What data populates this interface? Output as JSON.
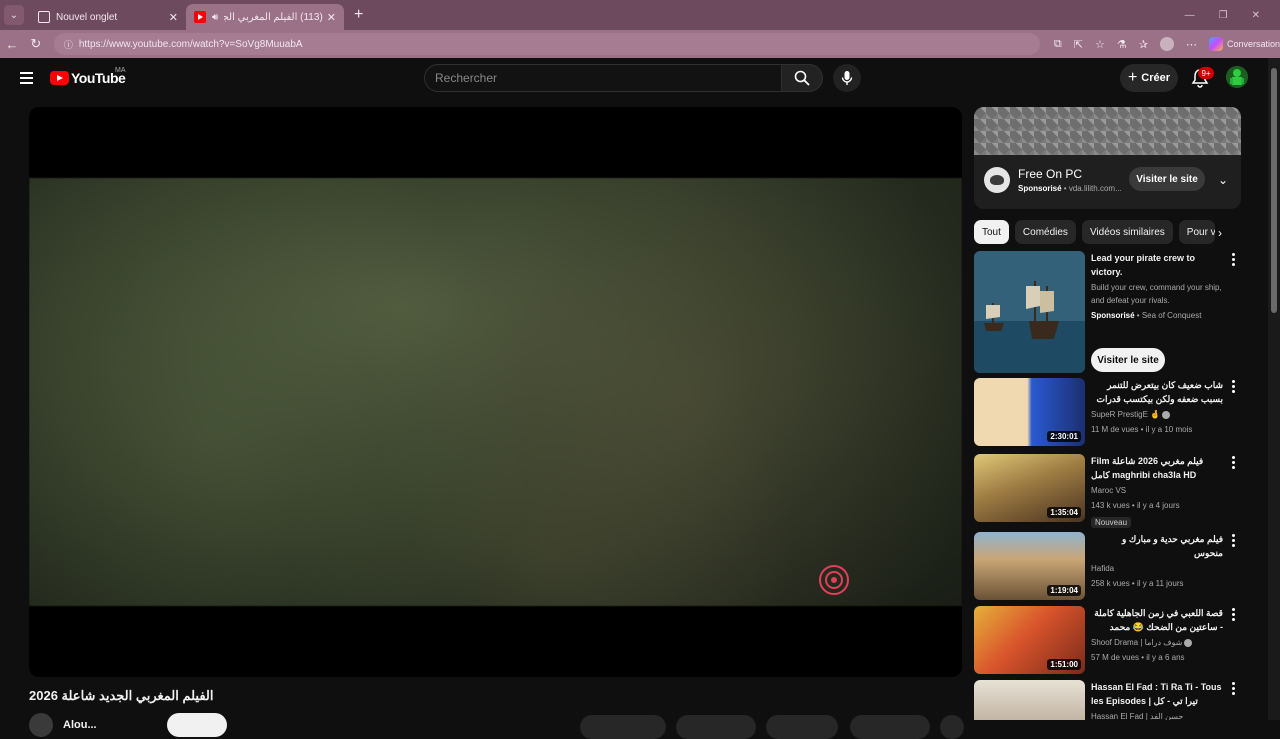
{
  "browser": {
    "tabs": [
      {
        "label": "Nouvel onglet",
        "active": false
      },
      {
        "label": "(113) الفيلم المغربي الجديد شا...",
        "active": true
      }
    ],
    "url": "https://www.youtube.com/watch?v=SoVg8MuuabA",
    "copilot_label": "Conversation"
  },
  "header": {
    "logo_text": "YouTube",
    "country": "MA",
    "search_placeholder": "Rechercher",
    "create_label": "Créer",
    "notif_count": "9+"
  },
  "video": {
    "title": "الفيلم المغربي الجديد شاعلة 2026",
    "channel": "Alou..."
  },
  "ad": {
    "title": "Free On PC",
    "sponsored": "Sponsorisé",
    "domain": "vda.lilith.com...",
    "visit_label": "Visiter le site"
  },
  "chips": [
    "Tout",
    "Comédies",
    "Vidéos similaires",
    "Pour vous"
  ],
  "recommendations": [
    {
      "title": "Lead your pirate crew to victory.",
      "description": "Build your crew, command your ship, and defeat your rivals.",
      "sponsored": "Sponsorisé",
      "advertiser": "Sea of Conquest",
      "visit_label": "Visiter le site",
      "thumb_colors": [
        "#3d6e86",
        "#1d3a4f"
      ]
    },
    {
      "title": "شاب ضعيف كان بيتعرض للتنمر بسبب ضعفه ولكن بيكتسب قدرات خارقه بتخليه ...",
      "channel": "SupeR PrestigE 🤞",
      "stats": "11 M de vues • il y a 10 mois",
      "duration": "2:30:01",
      "thumb_colors": [
        "#5f9fd8",
        "#203a6e"
      ]
    },
    {
      "title": "Film فيلم مغربي 2026 شاعلة كامل maghribi cha3la HD",
      "channel": "Maroc VS",
      "stats": "143 k vues • il y a 4 jours",
      "badge": "Nouveau",
      "duration": "1:35:04",
      "thumb_colors": [
        "#c9b26a",
        "#5a3c20"
      ]
    },
    {
      "title": "فيلم مغربي حدية و مبارك و منحوس",
      "channel": "Hafida",
      "stats": "258 k vues • il y a 11 jours",
      "duration": "1:19:04",
      "thumb_colors": [
        "#a98e64",
        "#4f3d2a"
      ]
    },
    {
      "title": "قصة اللعبي في زمن الجاهلية كاملة - ساعتين من الضحك 😂 محمد سعد - فيلم اطاطا",
      "channel": "Shoof Drama | شوف دراما",
      "stats": "57 M de vues • il y a 6 ans",
      "duration": "1:51:00",
      "thumb_colors": [
        "#e04a2a",
        "#f0c040"
      ]
    },
    {
      "title": "Hassan El Fad : Ti Ra Ti - Tous les Episodes | تيرا تي - كل الحلقات",
      "channel": "Hassan El Fad | حسن الفد",
      "stats": "",
      "duration": "",
      "thumb_colors": [
        "#d8d0c2",
        "#7d6b5a"
      ]
    }
  ]
}
